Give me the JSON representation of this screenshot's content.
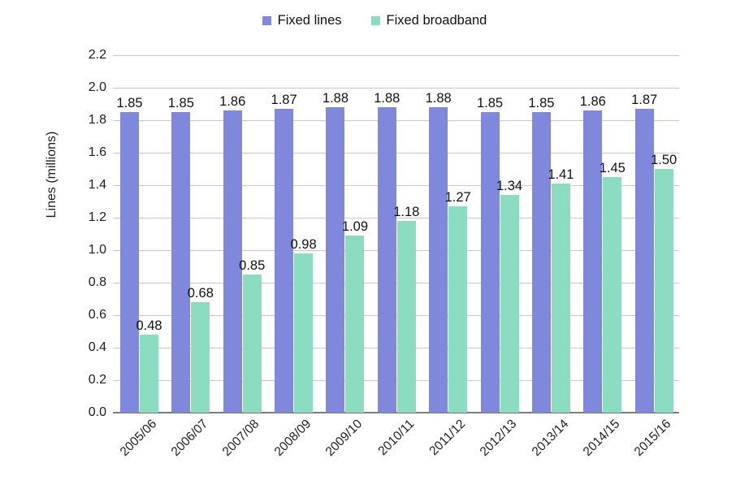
{
  "chart_data": {
    "type": "bar",
    "title": "",
    "xlabel": "",
    "ylabel": "Lines (millions)",
    "ylim": [
      0.0,
      2.2
    ],
    "ytick_step": 0.2,
    "yticks": [
      "2.2",
      "2.0",
      "1.8",
      "1.6",
      "1.4",
      "1.2",
      "1.0",
      "0.8",
      "0.6",
      "0.4",
      "0.2",
      "0.0"
    ],
    "grid": true,
    "legend_position": "top-center",
    "categories": [
      "2005/06",
      "2006/07",
      "2007/08",
      "2008/09",
      "2009/10",
      "2010/11",
      "2011/12",
      "2012/13",
      "2013/14",
      "2014/15",
      "2015/16"
    ],
    "series": [
      {
        "name": "Fixed lines",
        "color": "#8088dc",
        "values": [
          1.85,
          1.85,
          1.86,
          1.87,
          1.88,
          1.88,
          1.88,
          1.85,
          1.85,
          1.86,
          1.87
        ],
        "labels": [
          "1.85",
          "1.85",
          "1.86",
          "1.87",
          "1.88",
          "1.88",
          "1.88",
          "1.85",
          "1.85",
          "1.86",
          "1.87"
        ]
      },
      {
        "name": "Fixed broadband",
        "color": "#8bdcc0",
        "values": [
          0.48,
          0.68,
          0.85,
          0.98,
          1.09,
          1.18,
          1.27,
          1.34,
          1.41,
          1.45,
          1.5
        ],
        "labels": [
          "0.48",
          "0.68",
          "0.85",
          "0.98",
          "1.09",
          "1.18",
          "1.27",
          "1.34",
          "1.41",
          "1.45",
          "1.50"
        ]
      }
    ],
    "colors": {
      "series_fixed_lines": "#8088dc",
      "series_fixed_broadband": "#8bdcc0",
      "gridline": "#c9c9c9",
      "axis": "#7c7c7c",
      "text": "#1d1d1d",
      "background": "#ffffff"
    }
  },
  "legend": {
    "items": [
      {
        "label": "Fixed lines",
        "color": "#8088dc",
        "icon": "square-swatch-icon"
      },
      {
        "label": "Fixed broadband",
        "color": "#8bdcc0",
        "icon": "square-swatch-icon"
      }
    ]
  }
}
